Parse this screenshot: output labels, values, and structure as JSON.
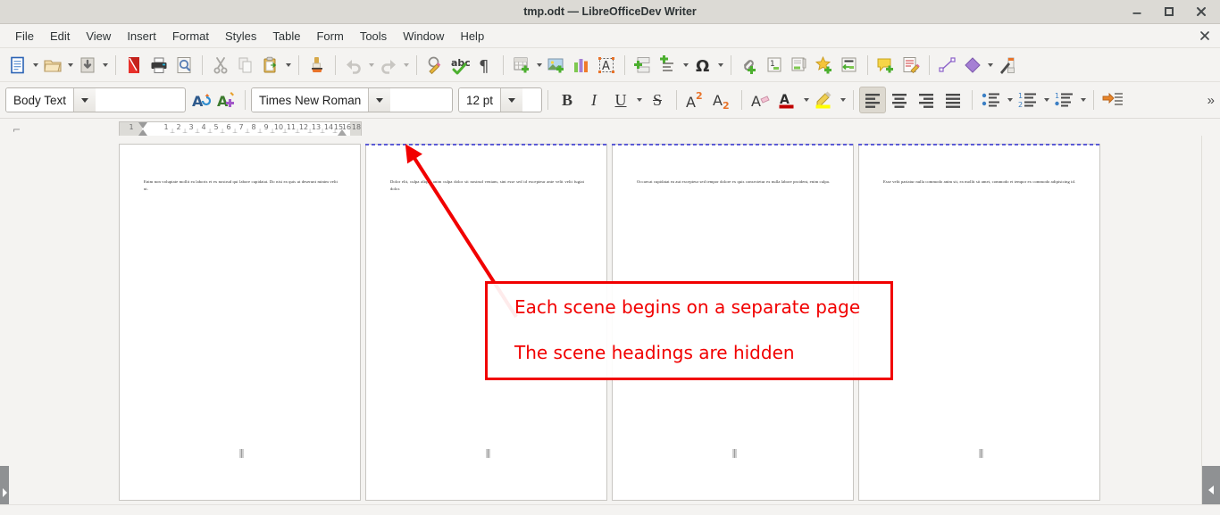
{
  "window": {
    "title": "tmp.odt — LibreOfficeDev Writer",
    "controls": {
      "minimize": "minimize-button",
      "maximize": "maximize-button",
      "close": "close-button"
    }
  },
  "menubar": {
    "items": [
      {
        "label": "File"
      },
      {
        "label": "Edit"
      },
      {
        "label": "View"
      },
      {
        "label": "Insert"
      },
      {
        "label": "Format"
      },
      {
        "label": "Styles"
      },
      {
        "label": "Table"
      },
      {
        "label": "Form"
      },
      {
        "label": "Tools"
      },
      {
        "label": "Window"
      },
      {
        "label": "Help"
      }
    ],
    "close_doc": "×"
  },
  "standard_toolbar": {
    "buttons": [
      "new-document-icon",
      "open-document-icon",
      "save-document-icon",
      "export-pdf-icon",
      "print-icon",
      "print-preview-icon",
      "cut-icon",
      "copy-icon",
      "paste-icon",
      "clone-formatting-icon",
      "undo-icon",
      "redo-icon",
      "find-replace-icon",
      "spelling-icon",
      "formatting-marks-icon",
      "insert-table-icon",
      "insert-image-icon",
      "insert-chart-icon",
      "insert-textbox-icon",
      "insert-page-break-icon",
      "insert-field-icon",
      "insert-special-character-icon",
      "insert-hyperlink-icon",
      "insert-footnote-icon",
      "insert-endnote-icon",
      "insert-bookmark-icon",
      "insert-cross-reference-icon",
      "insert-comment-icon",
      "track-changes-icon",
      "insert-line-icon",
      "basic-shapes-icon",
      "show-draw-functions-icon"
    ]
  },
  "format_toolbar": {
    "paragraph_style": {
      "value": "Body Text"
    },
    "update_style_icon": "update-style-icon",
    "new_style_icon": "new-style-icon",
    "font_name": {
      "value": "Times New Roman"
    },
    "font_size": {
      "value": "12 pt"
    },
    "bold": "B",
    "italic": "I",
    "underline": "U",
    "strikethrough": "S",
    "superscript": "A2",
    "subscript": "A2",
    "clear_formatting_icon": "clear-formatting-icon",
    "font_color_icon": "font-color-icon",
    "highlight_color_icon": "highlighting-color-icon",
    "align_left_icon": "align-left-icon",
    "align_center_icon": "align-center-icon",
    "align_right_icon": "align-right-icon",
    "align_justified_icon": "align-justified-icon",
    "unordered_list_icon": "unordered-list-icon",
    "ordered_list_icon": "ordered-list-icon",
    "outline_list_icon": "outline-list-icon",
    "increase_indent_icon": "increase-indent-icon",
    "overflow": "»"
  },
  "ruler": {
    "corner_glyph": "⌐",
    "numbers": [
      "1",
      "1",
      "2",
      "3",
      "4",
      "5",
      "6",
      "7",
      "8",
      "9",
      "10",
      "11",
      "12",
      "13",
      "14",
      "15",
      "16",
      "17",
      "18"
    ],
    "tab_marks": [
      "⊥",
      "⊥",
      "⊥",
      "⊥",
      "⊥",
      "⊥",
      "⊥",
      "⊥",
      "⊥",
      "⊥",
      "⊥",
      "⊥",
      "⊥",
      "⊥",
      "⊥",
      "⊥",
      "⊥"
    ]
  },
  "document": {
    "pages": [
      {
        "text": "Enim non voluptate mollit ea laboris et ex nostrud qui labore cupidatat. Do nisi ea quis ut deserunt minim velit ut.",
        "has_page_break_line": false,
        "hidden_mark": "hidden-section-mark"
      },
      {
        "text": "Dolor elit, culpa aliqua anim culpa dolor sit nostrud veniam, sint esse sed id excepteur ante velit velit fugiat dolor.",
        "has_page_break_line": true,
        "hidden_mark": "hidden-section-mark"
      },
      {
        "text": "Occaecat cupidatat ea aut excepteur sed tempor dolore ex quis consectetur ex nulla labore proident, enim culpa.",
        "has_page_break_line": true,
        "hidden_mark": "hidden-section-mark"
      },
      {
        "text": "Esse velit pariatur nulla commodo anim sit, ea mollit sit amet, commodo et tempor ex commodo adipisicing id.",
        "has_page_break_line": true,
        "hidden_mark": "hidden-section-mark"
      }
    ]
  },
  "annotation": {
    "line1": "Each scene begins on a separate page",
    "line2": "The scene headings are hidden",
    "color": "#f10000",
    "arrow": "arrow-pointing-to-page-two"
  },
  "sidebars": {
    "left_tab": "show-left-panel-tab",
    "right_tab": "show-sidebar-tab"
  },
  "colors": {
    "titlebar_bg": "#dcdad5",
    "toolbar_bg": "#f4f3f1",
    "page_bg": "#ffffff",
    "page_break_line": "#5b5bd6",
    "annotation_red": "#f10000"
  }
}
